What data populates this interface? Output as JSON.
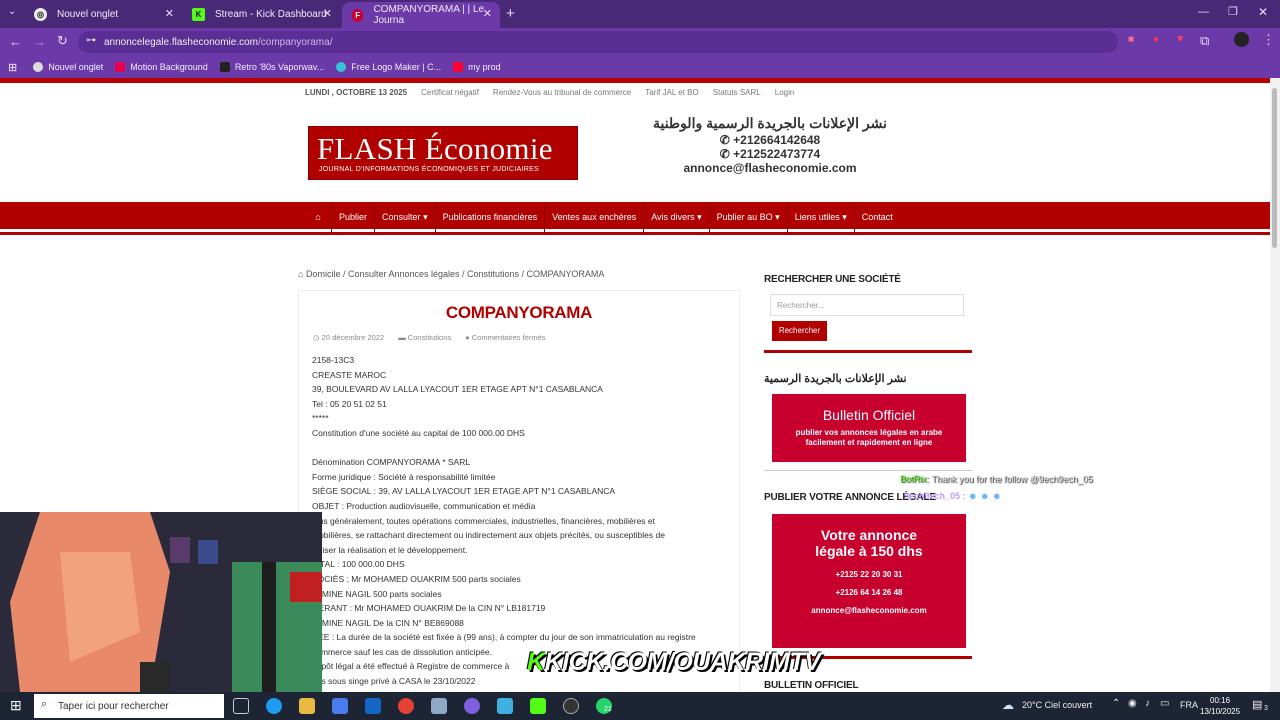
{
  "browser": {
    "tabs": [
      {
        "title": "Nouvel onglet"
      },
      {
        "title": "Stream - Kick Dashboard"
      },
      {
        "title": "COMPANYORAMA | | Le Journa"
      }
    ],
    "url_host": "annoncelegale.flasheconomie.com",
    "url_path": "/companyorama/",
    "bookmarks": [
      "Nouvel onglet",
      "Motion Background",
      "Retro '80s Vaporwav...",
      "Free Logo Maker | C...",
      "my prod"
    ]
  },
  "site": {
    "toplinks": [
      "LUNDI , OCTOBRE 13 2025",
      "Certificat négatif",
      "Rendez-Vous au tribunal de commerce",
      "Tarif JAL et BO",
      "Statuts SARL",
      "Login"
    ],
    "logo_title": "FLASH Économie",
    "logo_subtitle": "JOURNAL D'INFORMATIONS ÉCONOMIQUES ET JUDICIAIRES",
    "header_ar": "نشر الإعلانات بالجريدة الرسمية والوطنية",
    "phone1": "+212664142648",
    "phone2": "+212522473774",
    "email": "annonce@flasheconomie.com",
    "nav": [
      "Publier",
      "Consulter",
      "Publications financières",
      "Ventes aux enchères",
      "Avis divers",
      "Publier au BO",
      "Liens utiles",
      "Contact"
    ]
  },
  "breadcrumb": "Domicile / Consulter Annonces légales / Constitutions / COMPANYORAMA",
  "article": {
    "title": "COMPANYORAMA",
    "date": "20 décembre 2022",
    "category": "Constitutions",
    "comments": "Commentaires fermés",
    "lines": [
      "2158-13C3",
      "CREASTE MAROC",
      "39, BOULEVARD AV LALLA LYACOUT 1ER ETAGE APT N°1 CASABLANCA",
      "Tel : 05 20 51 02 51",
      "*****",
      "Constitution d'une société au capital de 100 000.00 DHS",
      "",
      "Dénomination COMPANYORAMA * SARL",
      "Forme juridique : Société à responsabilité limitée",
      "SIÈGE SOCIAL : 39, AV LALLA LYACOUT 1ER ETAGE APT N°1 CASABLANCA",
      "OBJET : Production audiovisuelle, communication et média",
      "plus généralement, toutes opérations commerciales, industrielles, financières, mobilières et",
      "mobilières, se rattachant directement ou indirectement aux objets précités, ou susceptibles de",
      "roriser la réalisation et le développement.",
      "PITAL : 100 000.00 DHS",
      "SOCIÉS : Mr MOHAMED OUAKRIM 500 parts sociales",
      ". AMINE NAGIL 500 parts sociales",
      "GÉRANT : Mr MOHAMED OUAKRIM De la CIN N° LB181719",
      ". AMINE NAGIL De la CIN N° BE869088",
      "RÉE : La durée de la société est fixée à (99 ans), à compter du jour de son immatriculation au registre",
      "commerce sauf les cas de dissolution anticipée.",
      "dépôt légal a été effectué à Registre de commerce à",
      "tuts sous singe privé à CASA le 23/10/2022"
    ]
  },
  "sidebar": {
    "search_heading": "RECHERCHER UNE SOCIÉTÉ",
    "search_placeholder": "Rechercher...",
    "search_button": "Rechercher",
    "bo_heading": "نشر الإعلانات بالجريدة الرسمية",
    "bo_title": "Bulletin Officiel",
    "bo_text": "publier vos annonces légales en arabe facilement et rapidement en ligne",
    "publish_heading": "PUBLIER VOTRE ANNONCE LÉGALE",
    "publish_title": "Votre annonce légale à 150 dhs",
    "publish_phone1": "+2125 22 20 30 31",
    "publish_phone2": "+2126 64 14 26 48",
    "publish_email": "annonce@flasheconomie.com",
    "bottom_heading": "BULLETIN OFFICIEL"
  },
  "overlay": {
    "kick_k": "K",
    "kick_text": "KICK.COM/OUAKRIMTV",
    "chat_bot": "BotRix",
    "chat_msg": ": Thank you for the follow @9ech9ech_05",
    "chat_user": "9ech9ech_05 :"
  },
  "taskbar": {
    "search": "Taper ici pour rechercher",
    "weather": "20°C  Ciel couvert",
    "lang": "FRA",
    "time": "00:16",
    "date": "13/10/2025",
    "badge": "21",
    "notif": "3"
  }
}
